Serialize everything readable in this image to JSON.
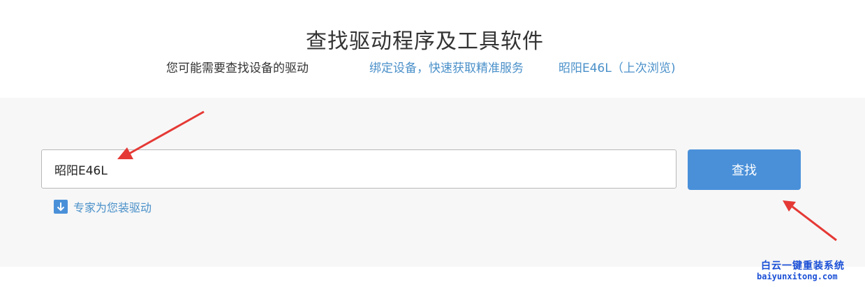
{
  "header": {
    "title": "查找驱动程序及工具软件",
    "subtitle": "您可能需要查找设备的驱动",
    "bind_device_link": "绑定设备，快速获取精准服务",
    "recent_device_link": "昭阳E46L（上次浏览)"
  },
  "search": {
    "input_value": "昭阳E46L",
    "button_label": "查找",
    "expert_link": "专家为您装驱动",
    "expert_icon": "download-icon"
  },
  "annotations": {
    "arrow_color": "#e53935"
  },
  "watermark": {
    "cn": "白云一键重装系统",
    "en": "baiyunxitong.com"
  },
  "colors": {
    "accent": "#4a90d9",
    "link": "#4a90c9",
    "panel_bg": "#f7f7f7"
  }
}
